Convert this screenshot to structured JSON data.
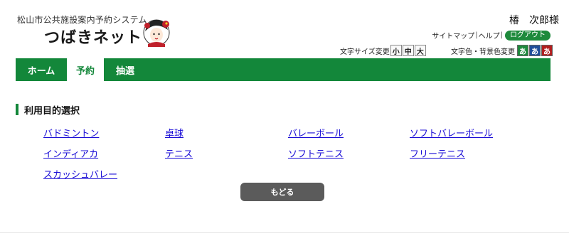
{
  "header": {
    "logo_subtitle": "松山市公共施設案内予約システム",
    "logo_title": "つばきネット",
    "user_name": "椿　次郎様",
    "util_links": {
      "sitemap": "サイトマップ",
      "help": "ヘルプ",
      "logout": "ログアウト",
      "separator": "|"
    },
    "font_size": {
      "label": "文字サイズ変更",
      "options": [
        "小",
        "中",
        "大"
      ]
    },
    "color_scheme": {
      "label": "文字色・背景色変更",
      "options": [
        "あ",
        "あ",
        "あ"
      ],
      "colors": [
        "#1e8a3c",
        "#1f4e9a",
        "#b21e1e"
      ]
    }
  },
  "nav": {
    "tabs": [
      {
        "label": "ホーム",
        "active": false
      },
      {
        "label": "予約",
        "active": true
      },
      {
        "label": "抽選",
        "active": false
      }
    ]
  },
  "main": {
    "section_title": "利用目的選択",
    "purposes": [
      "バドミントン",
      "卓球",
      "バレーボール",
      "ソフトバレーボール",
      "インディアカ",
      "テニス",
      "ソフトテニス",
      "フリーテニス",
      "スカッシュバレー"
    ],
    "back_label": "もどる"
  },
  "colors": {
    "accent": "#13873a",
    "link": "#1a0dd6",
    "button": "#5b5b5b"
  }
}
